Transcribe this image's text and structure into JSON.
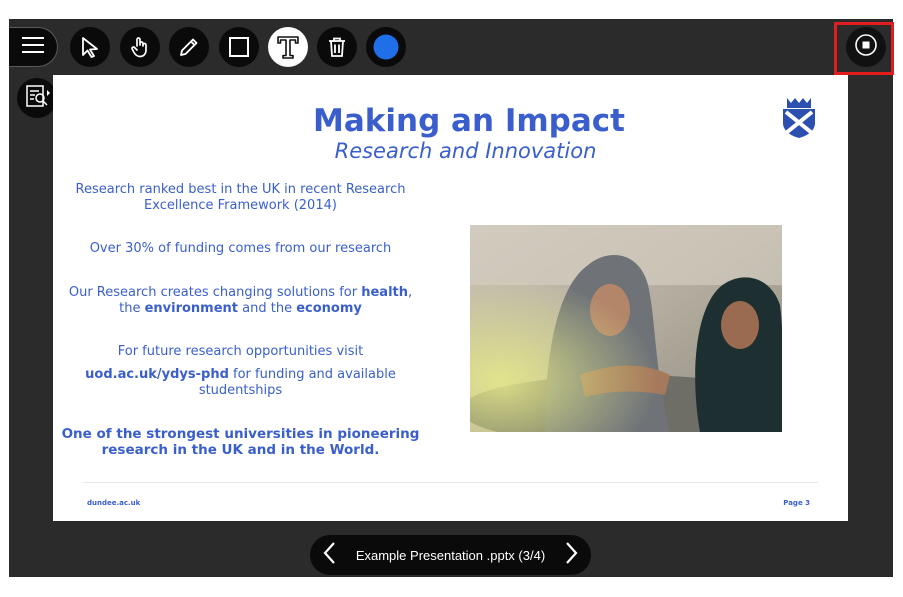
{
  "toolbar": {
    "tools": [
      {
        "name": "pointer-tool",
        "icon": "arrow-cursor-icon"
      },
      {
        "name": "pan-tool",
        "icon": "hand-icon"
      },
      {
        "name": "pen-tool",
        "icon": "pencil-icon"
      },
      {
        "name": "shape-tool",
        "icon": "square-icon"
      },
      {
        "name": "text-tool",
        "icon": "text-icon",
        "active": true
      },
      {
        "name": "delete-tool",
        "icon": "trash-icon"
      },
      {
        "name": "color-picker",
        "icon": "color-dot-icon",
        "color": "#1f6fe8"
      }
    ]
  },
  "slide": {
    "title": "Making an Impact",
    "subtitle": "Research and Innovation",
    "bullets": {
      "b1": "Research ranked best in the UK in recent Research Excellence Framework (2014)",
      "b2": "Over 30% of funding comes from our research",
      "b3_pre": "Our Research creates changing solutions for ",
      "b3_health": "health",
      "b3_comma": ",",
      "b3_the": "the ",
      "b3_environment": "environment",
      "b3_and": " and the ",
      "b3_economy": "economy",
      "b4_line1": "For future research opportunities visit",
      "b4_link": "uod.ac.uk/ydys-phd",
      "b4_rest": " for funding and available studentships",
      "b5": "One of the strongest universities in pioneering research in the UK and in the World."
    },
    "footer_left": "dundee.ac.uk",
    "footer_right": "Page  3"
  },
  "navigation": {
    "presentation_title": "Example Presentation .pptx   (3/4)"
  },
  "colors": {
    "accent": "#3a5fcc",
    "stop_highlight": "#e11d1d",
    "background": "#2b2b2b"
  }
}
